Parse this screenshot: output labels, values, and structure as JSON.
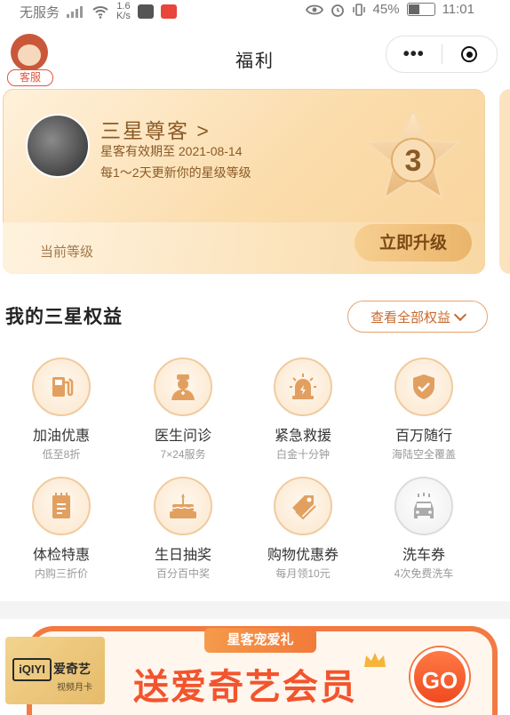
{
  "status_bar": {
    "carrier": "无服务",
    "speed_value": "1.6",
    "speed_unit": "K/s",
    "battery": "45%",
    "time": "11:01"
  },
  "nav": {
    "customer_service": "客服",
    "title": "福利",
    "more": "•••"
  },
  "member_card": {
    "level_title": "三星尊客 >",
    "validity": "星客有效期至 2021-08-14",
    "update_note": "每1～2天更新你的星级等级",
    "current_level_label": "当前等级",
    "upgrade_button": "立即升级",
    "star_level": "3"
  },
  "benefits_section": {
    "title": "我的三星权益",
    "view_all": "查看全部权益"
  },
  "benefits": [
    {
      "name": "加油优惠",
      "sub": "低至8折",
      "icon": "fuel-pump-icon",
      "active": true
    },
    {
      "name": "医生问诊",
      "sub": "7×24服务",
      "icon": "doctor-icon",
      "active": true
    },
    {
      "name": "紧急救援",
      "sub": "白金十分钟",
      "icon": "siren-icon",
      "active": true
    },
    {
      "name": "百万随行",
      "sub": "海陆空全覆盖",
      "icon": "shield-check-icon",
      "active": true
    },
    {
      "name": "体检特惠",
      "sub": "内购三折价",
      "icon": "notebook-icon",
      "active": true
    },
    {
      "name": "生日抽奖",
      "sub": "百分百中奖",
      "icon": "cake-icon",
      "active": true
    },
    {
      "name": "购物优惠券",
      "sub": "每月领10元",
      "icon": "tag-icon",
      "active": true
    },
    {
      "name": "洗车券",
      "sub": "4次免费洗车",
      "icon": "car-wash-icon",
      "active": false
    }
  ],
  "promo": {
    "tag": "星客宠爱礼",
    "logo_text": "iQIYI",
    "brand": "爱奇艺",
    "card_type": "视频月卡",
    "headline": "送爱奇艺会员",
    "go": "GO"
  },
  "colors": {
    "accent": "#f37a43",
    "gold_text": "#8a5a26",
    "card_bg": "#fbdcab"
  }
}
